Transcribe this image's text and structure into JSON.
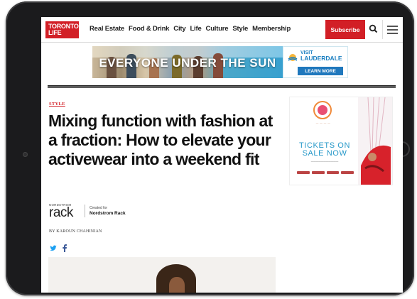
{
  "site": {
    "logo_line1": "TORONTO",
    "logo_line2": "LIFE",
    "nav": [
      "Real Estate",
      "Food & Drink",
      "City",
      "Life",
      "Culture",
      "Style",
      "Membership"
    ],
    "subscribe_label": "Subscribe",
    "search_icon": "search-icon",
    "menu_icon": "hamburger-menu-icon",
    "brand_color": "#d21f26"
  },
  "ad_banner": {
    "headline": "EVERYONE UNDER THE SUN",
    "brand_prefix": "VISIT",
    "brand_name": "LAUDERDALE",
    "cta": "LEARN MORE",
    "accent": "#1f78bd"
  },
  "article": {
    "category": "STYLE",
    "headline": "Mixing function with fashion at a fraction: How to elevate your activewear into a weekend fit",
    "sponsor_logo_small": "NORDSTROM",
    "sponsor_logo_big": "rack",
    "sponsor_created_for": "Created for",
    "sponsor_name": "Nordstrom Rack",
    "byline": "BY KAROUN CHAHINIAN",
    "share_icons": [
      "twitter-icon",
      "facebook-icon"
    ]
  },
  "side_ad": {
    "headline_line1": "TICKETS ON",
    "headline_line2": "SALE NOW",
    "accent": "#2799c9"
  }
}
